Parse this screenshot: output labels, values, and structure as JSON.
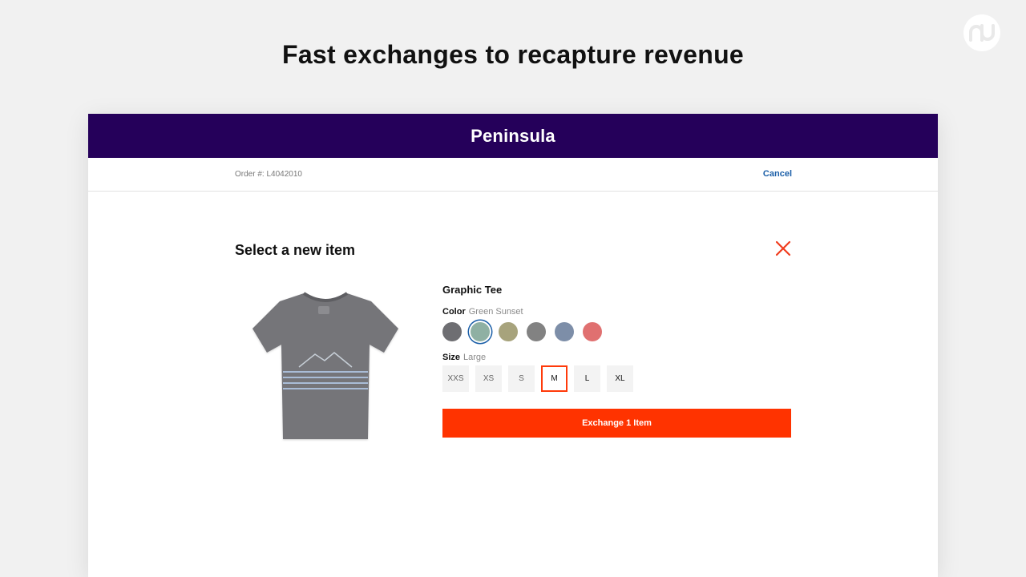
{
  "hero": {
    "title": "Fast exchanges to recapture revenue"
  },
  "store": {
    "name": "Peninsula"
  },
  "order": {
    "number_label": "Order #: L4042010",
    "cancel_label": "Cancel"
  },
  "modal": {
    "title": "Select a new item"
  },
  "product": {
    "name": "Graphic Tee",
    "color_label": "Color",
    "color_value": "Green Sunset",
    "size_label": "Size",
    "size_value": "Large",
    "swatches": [
      {
        "color": "#6e6e72",
        "selected": false
      },
      {
        "color": "#8fb0a3",
        "selected": true
      },
      {
        "color": "#a7a37c",
        "selected": false
      },
      {
        "color": "#828282",
        "selected": false
      },
      {
        "color": "#7d8ea8",
        "selected": false
      },
      {
        "color": "#e07070",
        "selected": false
      }
    ],
    "sizes": [
      {
        "label": "XXS",
        "selected": false
      },
      {
        "label": "XS",
        "selected": false
      },
      {
        "label": "S",
        "selected": false
      },
      {
        "label": "M",
        "selected": true
      },
      {
        "label": "L",
        "selected": false
      },
      {
        "label": "XL",
        "selected": false
      }
    ]
  },
  "actions": {
    "exchange_label": "Exchange 1 Item"
  },
  "colors": {
    "header": "#25005a",
    "accent": "#ff3300",
    "link": "#1b5fa8"
  }
}
